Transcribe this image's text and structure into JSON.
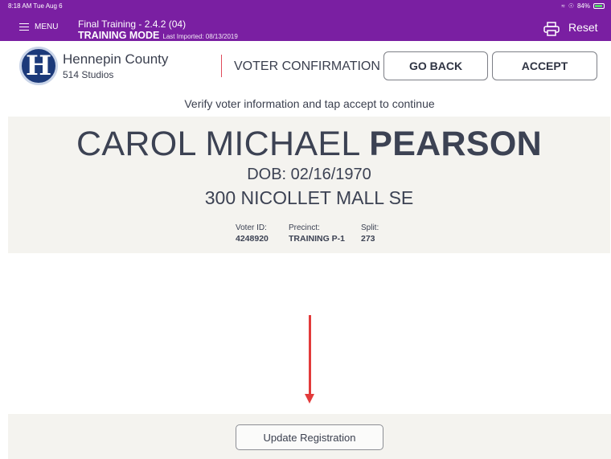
{
  "status_bar": {
    "time": "8:18 AM  Tue Aug 6",
    "battery": "84%"
  },
  "topbar": {
    "menu_label": "MENU",
    "title": "Final Training - 2.4.2 (04)",
    "mode": "TRAINING MODE",
    "last_imported": "Last Imported: 08/13/2019",
    "reset_label": "Reset"
  },
  "header": {
    "logo_text": "H",
    "county": "Hennepin County",
    "site": "514 Studios",
    "screen_title": "VOTER CONFIRMATION",
    "go_back_label": "GO BACK",
    "accept_label": "ACCEPT"
  },
  "instruction": "Verify voter information and tap accept to continue",
  "voter": {
    "first_middle": "CAROL MICHAEL",
    "last": "PEARSON",
    "dob": "DOB: 02/16/1970",
    "address": "300 NICOLLET MALL SE",
    "voter_id_label": "Voter ID:",
    "voter_id": "4248920",
    "precinct_label": "Precinct:",
    "precinct": "TRAINING P-1",
    "split_label": "Split:",
    "split": "273"
  },
  "footer": {
    "update_label": "Update Registration"
  },
  "colors": {
    "topbar": "#7a1fa2",
    "panel": "#f4f3ef",
    "arrow": "#e23b3b",
    "separator": "#e04b5b"
  }
}
